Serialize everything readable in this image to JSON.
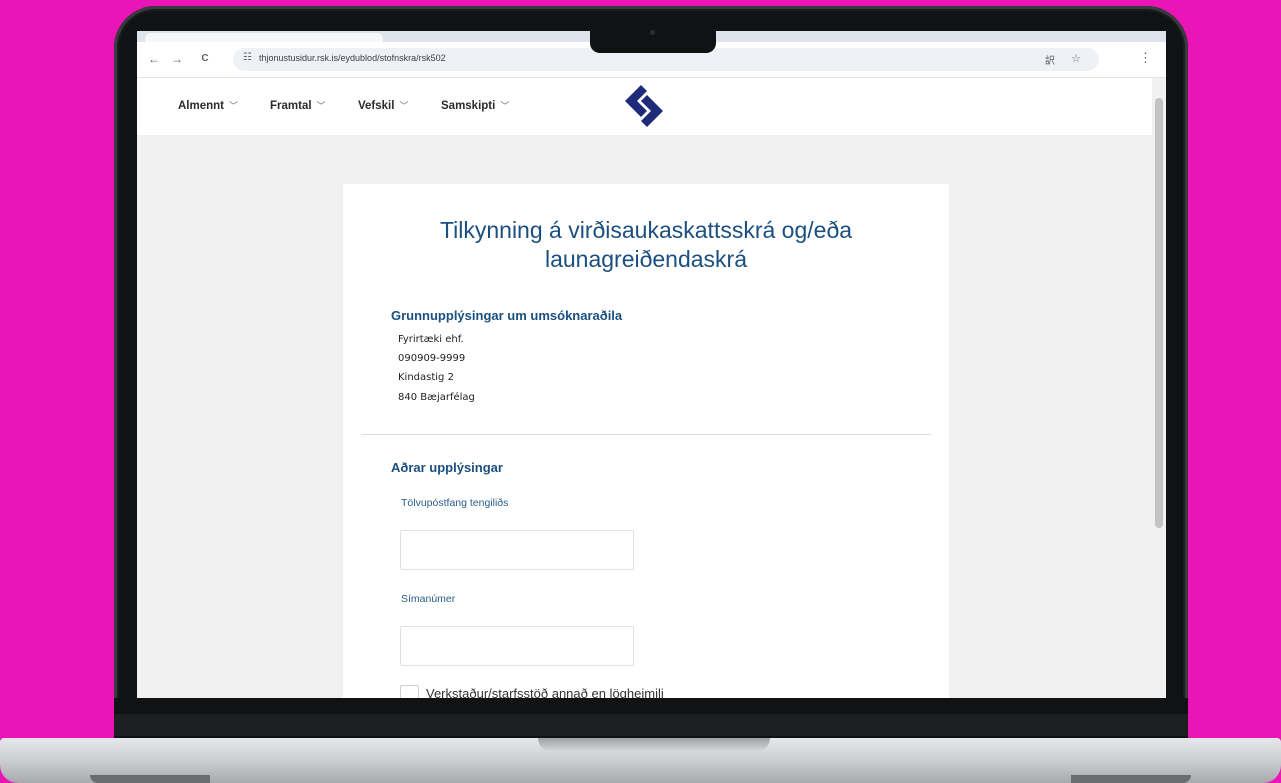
{
  "browser": {
    "url": "thjonustusidur.rsk.is/eydublod/stofnskra/rsk502",
    "back_icon": "←",
    "forward_icon": "→",
    "reload_icon": "C",
    "site_info_icon": "☷",
    "translate_icon": "訳",
    "bookmark_icon": "☆",
    "menu_icon": "⋮"
  },
  "nav": {
    "items": [
      {
        "label": "Almennt"
      },
      {
        "label": "Framtal"
      },
      {
        "label": "Vefskil"
      },
      {
        "label": "Samskipti"
      }
    ],
    "chevron": "﹀"
  },
  "colors": {
    "brand": "#1d2b7a",
    "heading": "#1b4f80",
    "background": "#ea15b6"
  },
  "form": {
    "title_line1": "Tilkynning á virðisaukaskattsskrá og/eða",
    "title_line2": "launagreiðendaskrá",
    "applicant": {
      "heading": "Grunnupplýsingar um umsóknaraðila",
      "name": "Fyrirtæki ehf.",
      "id": "090909-9999",
      "address": "Kindastig 2",
      "postal": "840 Bæjarfélag"
    },
    "other": {
      "heading": "Aðrar upplýsingar",
      "email_label": "Tölvupóstfang tengiliðs",
      "email_value": "",
      "phone_label": "Símanúmer",
      "phone_value": "",
      "checkbox_label": "Verkstaður/starfsstöð annað en lögheimili"
    }
  }
}
